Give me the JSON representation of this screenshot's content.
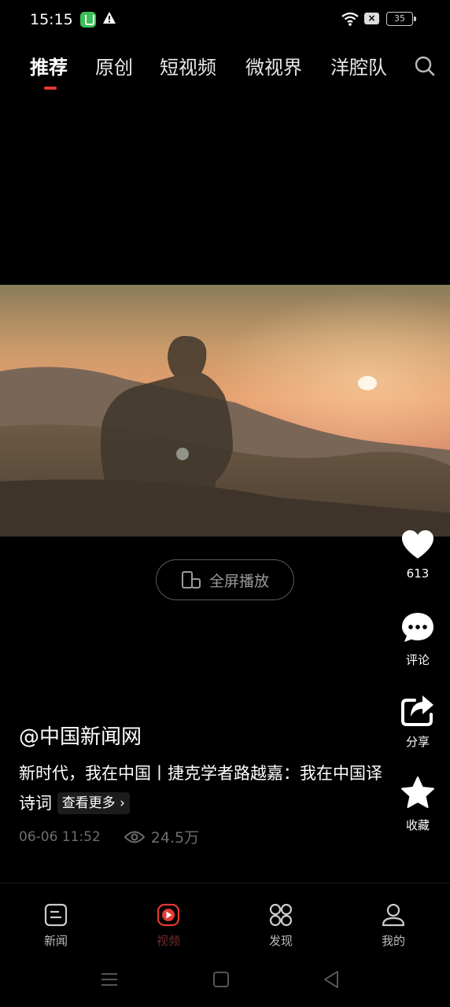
{
  "status": {
    "time": "15:15",
    "battery": "35"
  },
  "tabs": [
    {
      "label": "推荐",
      "active": true
    },
    {
      "label": "原创"
    },
    {
      "label": "短视频"
    },
    {
      "label": "微视界"
    },
    {
      "label": "洋腔队"
    }
  ],
  "player": {
    "fullscreen_label": "全屏播放"
  },
  "actions": {
    "like_count": "613",
    "comment_label": "评论",
    "share_label": "分享",
    "favorite_label": "收藏"
  },
  "post": {
    "author": "@中国新闻网",
    "description": "新时代，我在中国丨捷克学者路越嘉：我在中国译诗词",
    "more_label": "查看更多",
    "datetime": "06-06 11:52",
    "views": "24.5万"
  },
  "bottom_nav": {
    "news": "新闻",
    "video": "视频",
    "discover": "发现",
    "mine": "我的"
  },
  "colors": {
    "accent": "#e53935",
    "background": "#000000"
  }
}
